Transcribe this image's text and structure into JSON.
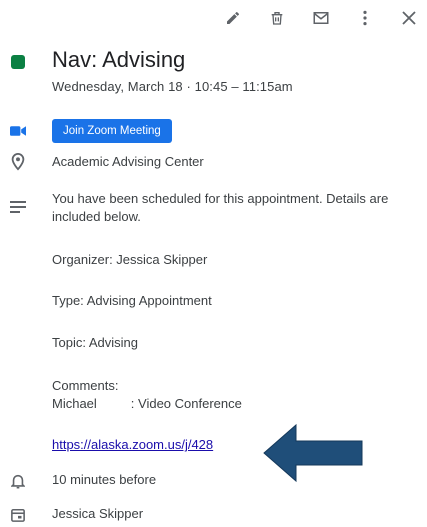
{
  "toolbar": {
    "edit_icon": "pencil-icon",
    "delete_icon": "trash-icon",
    "email_icon": "envelope-icon",
    "more_icon": "more-vert-icon",
    "close_icon": "close-icon"
  },
  "event": {
    "color": "#0b8043",
    "title": "Nav: Advising",
    "datetime": "Wednesday, March 18  ·  10:45 – 11:15am"
  },
  "zoom": {
    "button_label": "Join Zoom Meeting",
    "button_color": "#1a73e8"
  },
  "location": "Academic Advising Center",
  "description": {
    "intro": "You have been scheduled for this appointment. Details are included below.",
    "organizer": "Organizer: Jessica Skipper",
    "type": "Type: Advising Appointment",
    "topic": "Topic: Advising",
    "comments_label": "Comments:",
    "comments_name": "Michael",
    "comments_value": ": Video Conference",
    "link": "https://alaska.zoom.us/j/428"
  },
  "reminder": "10 minutes before",
  "calendar_owner": "Jessica Skipper",
  "annotation": {
    "arrow_color": "#1f4e79"
  }
}
